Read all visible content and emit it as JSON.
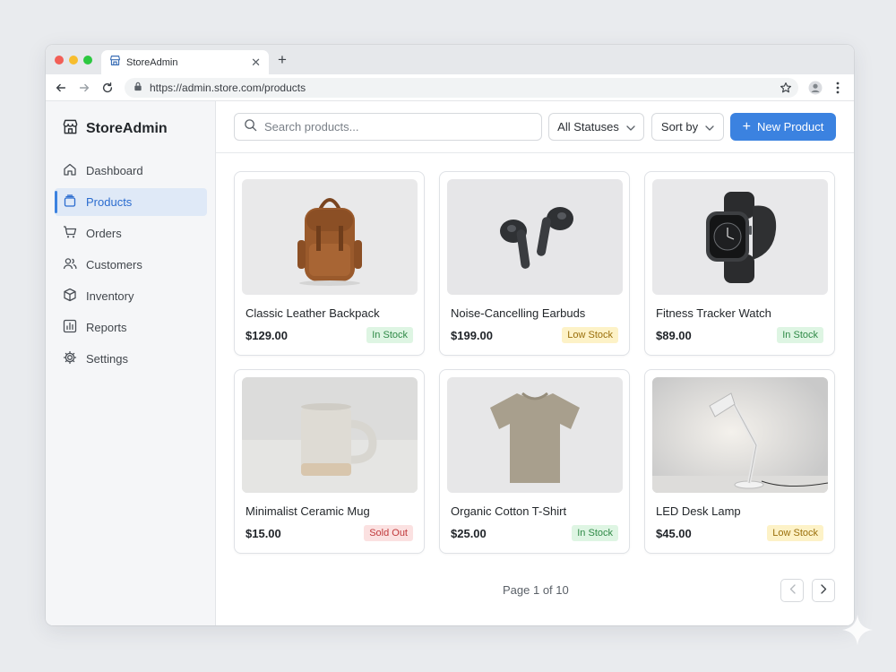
{
  "browser": {
    "tab_title": "StoreAdmin",
    "url": "https://admin.store.com/products"
  },
  "sidebar": {
    "brand": "StoreAdmin",
    "items": [
      {
        "label": "Dashboard",
        "icon": "home-icon",
        "active": false
      },
      {
        "label": "Products",
        "icon": "box-stack-icon",
        "active": true
      },
      {
        "label": "Orders",
        "icon": "cart-icon",
        "active": false
      },
      {
        "label": "Customers",
        "icon": "users-icon",
        "active": false
      },
      {
        "label": "Inventory",
        "icon": "cube-icon",
        "active": false
      },
      {
        "label": "Reports",
        "icon": "bar-chart-icon",
        "active": false
      },
      {
        "label": "Settings",
        "icon": "gear-icon",
        "active": false
      }
    ]
  },
  "toolbar": {
    "search_placeholder": "Search products...",
    "status_filter": "All Statuses",
    "sort_label": "Sort by",
    "new_product_label": "New Product"
  },
  "products": [
    {
      "name": "Classic Leather Backpack",
      "price": "$129.00",
      "status": "In Stock",
      "image": "backpack"
    },
    {
      "name": "Noise-Cancelling Earbuds",
      "price": "$199.00",
      "status": "Low Stock",
      "image": "earbuds"
    },
    {
      "name": "Fitness Tracker Watch",
      "price": "$89.00",
      "status": "In Stock",
      "image": "watch"
    },
    {
      "name": "Minimalist Ceramic Mug",
      "price": "$15.00",
      "status": "Sold Out",
      "image": "mug"
    },
    {
      "name": "Organic Cotton T-Shirt",
      "price": "$25.00",
      "status": "In Stock",
      "image": "tshirt"
    },
    {
      "name": "LED Desk Lamp",
      "price": "$45.00",
      "status": "Low Stock",
      "image": "lamp"
    }
  ],
  "pagination": {
    "text": "Page 1 of 10"
  },
  "colors": {
    "accent": "#3b82e0",
    "in_stock_bg": "#def5e3",
    "low_stock_bg": "#fdf2c7",
    "sold_out_bg": "#fbe1e1"
  }
}
